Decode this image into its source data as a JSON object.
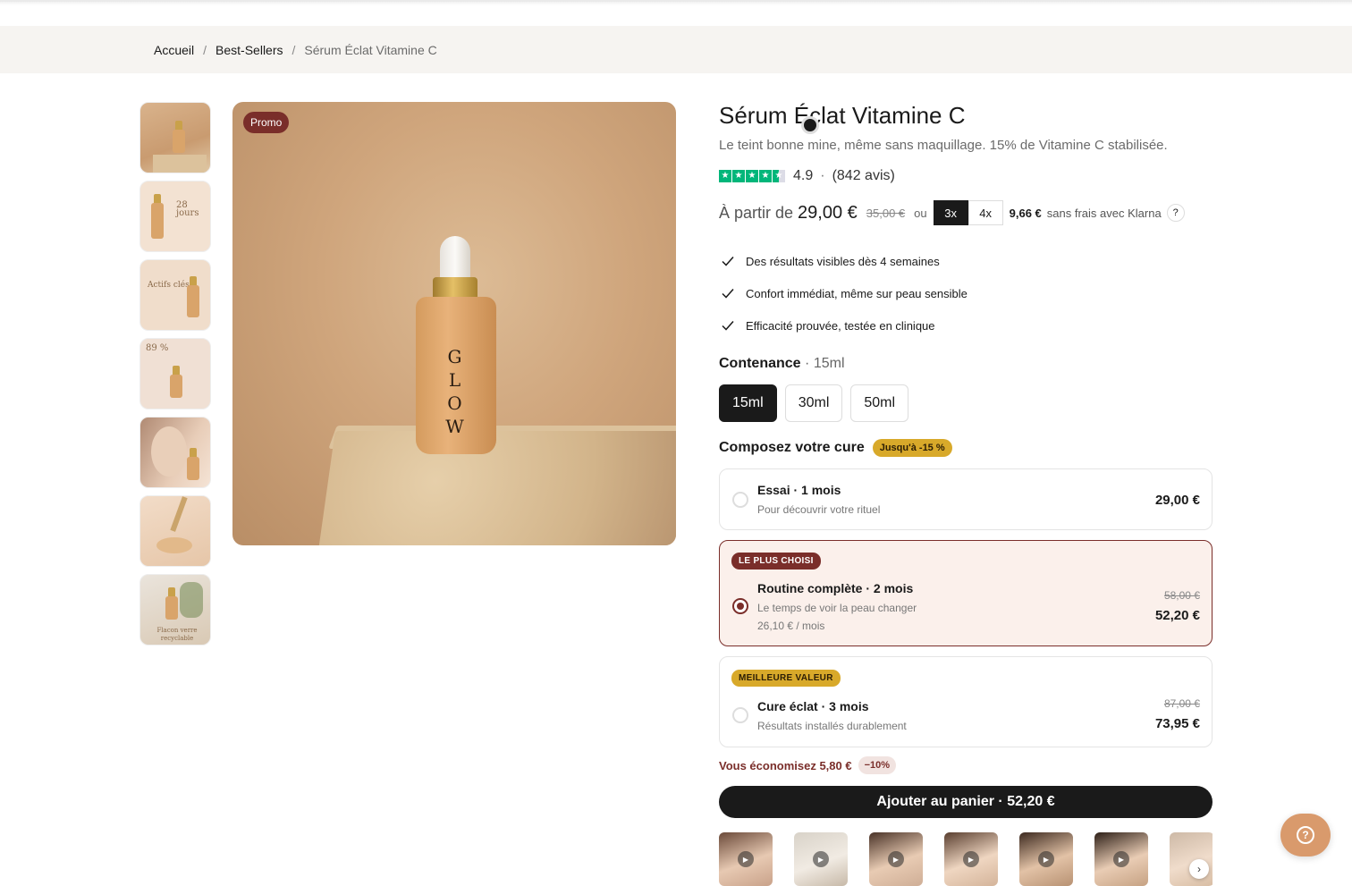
{
  "breadcrumb": {
    "items": [
      "Accueil",
      "Best-Sellers"
    ],
    "current": "Sérum Éclat Vitamine C",
    "separator": "/"
  },
  "gallery": {
    "promo_label": "Promo",
    "bottle_label": "GLOW",
    "thumbs": [
      {
        "name": "thumb-bottle-on-stone"
      },
      {
        "name": "thumb-results-28-days",
        "text": "28 jours"
      },
      {
        "name": "thumb-actifs-cles",
        "text": "Actifs clés"
      },
      {
        "name": "thumb-89-percent",
        "text": "89 %"
      },
      {
        "name": "thumb-model-applying"
      },
      {
        "name": "thumb-texture-dropper"
      },
      {
        "name": "thumb-recyclable-bottle",
        "text": "Flacon verre recyclable"
      }
    ]
  },
  "product": {
    "title": "Sérum Éclat Vitamine C",
    "subtitle": "Le teint bonne mine, même sans maquillage. 15% de Vitamine C stabilisée.",
    "rating": {
      "score": "4.9",
      "separator": "·",
      "reviews": "(842 avis)",
      "stars": 4.5
    },
    "price": {
      "from_label": "À partir de",
      "price": "29,00 €",
      "old_price": "35,00 €",
      "or_label": "ou",
      "installments": [
        "3x",
        "4x"
      ],
      "installment_amount": "9,66 €",
      "klarna_text": "sans frais avec Klarna",
      "help": "?"
    },
    "benefits": [
      "Des résultats visibles dès 4 semaines",
      "Confort immédiat, même sur peau sensible",
      "Efficacité prouvée, testée en clinique"
    ],
    "size": {
      "label": "Contenance",
      "selected_prefix": "·",
      "selected": "15ml",
      "options": [
        "15ml",
        "30ml",
        "50ml"
      ]
    },
    "cure": {
      "label": "Composez votre cure",
      "badge": "Jusqu'à -15 %",
      "plans": [
        {
          "name": "Essai · 1 mois",
          "desc": "Pour découvrir votre rituel",
          "price": "29,00 €"
        },
        {
          "badge": "LE PLUS CHOISI",
          "name": "Routine complète · 2 mois",
          "desc": "Le temps de voir la peau changer",
          "per_month": "26,10 € / mois",
          "old_price": "58,00 €",
          "price": "52,20 €"
        },
        {
          "badge": "MEILLEURE VALEUR",
          "name": "Cure éclat · 3 mois",
          "desc": "Résultats installés durablement",
          "old_price": "87,00 €",
          "price": "73,95 €"
        }
      ]
    },
    "savings": {
      "text": "Vous économisez 5,80 €",
      "pill": "−10%"
    },
    "add_to_cart": "Ajouter au panier  · 52,20 €"
  },
  "colors": {
    "accent": "#7a2e2a",
    "gold": "#d8a92a",
    "trustpilot": "#00b67a",
    "help_button": "#d99a6c"
  },
  "icons": {
    "check": "check-icon",
    "play": "play-icon",
    "next": "chevron-right-icon",
    "help": "question-circle-icon"
  }
}
